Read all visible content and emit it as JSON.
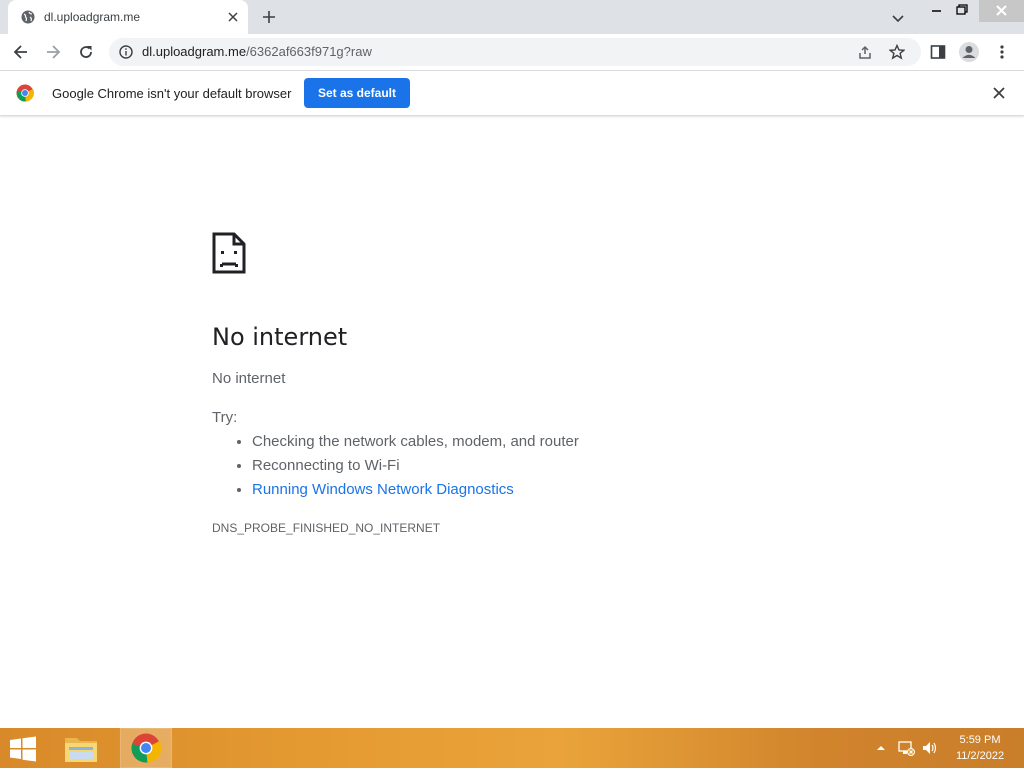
{
  "browser": {
    "tab": {
      "title": "dl.uploadgram.me"
    },
    "address_bar": {
      "host": "dl.uploadgram.me",
      "path": "/6362af663f971g?raw"
    },
    "infobar": {
      "message": "Google Chrome isn't your default browser",
      "button_label": "Set as default"
    },
    "accent_color": "#1a73e8"
  },
  "error_page": {
    "title": "No internet",
    "subtitle": "No internet",
    "try_label": "Try:",
    "suggestions": [
      "Checking the network cables, modem, and router",
      "Reconnecting to Wi-Fi",
      "Running Windows Network Diagnostics"
    ],
    "error_code": "DNS_PROBE_FINISHED_NO_INTERNET"
  },
  "taskbar": {
    "apps": [
      "file-explorer-icon",
      "chrome-icon"
    ],
    "clock": {
      "time": "5:59 PM",
      "date": "11/2/2022"
    }
  }
}
